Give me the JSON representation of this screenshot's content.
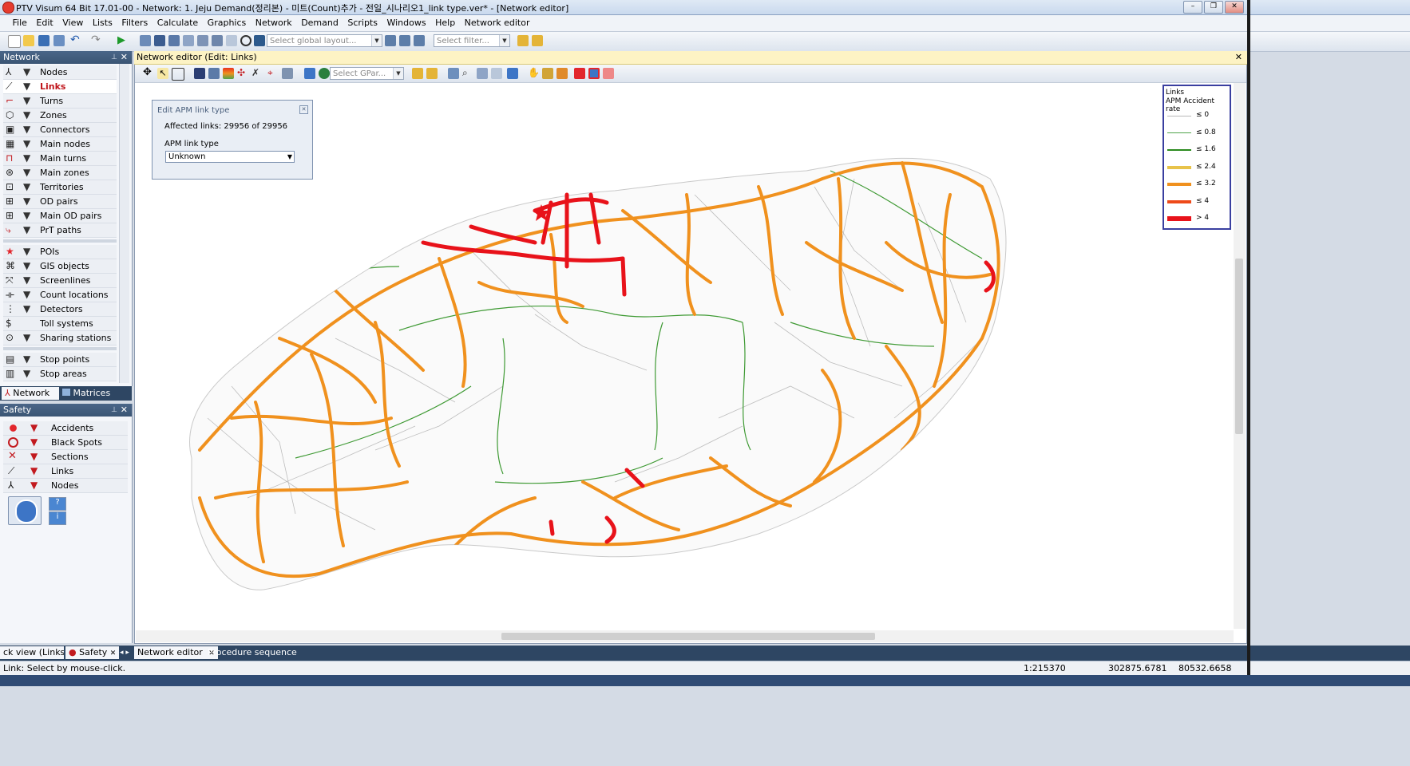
{
  "window": {
    "title": "PTV Visum 64 Bit 17.01-00 - Network: 1. Jeju Demand(정리본) - 미트(Count)추가 - 전일_시나리오1_link type.ver* - [Network editor]",
    "min": "–",
    "max": "❐",
    "close": "✕"
  },
  "menu": [
    "File",
    "Edit",
    "View",
    "Lists",
    "Filters",
    "Calculate",
    "Graphics",
    "Network",
    "Demand",
    "Scripts",
    "Windows",
    "Help",
    "Network editor"
  ],
  "toolbar": {
    "layout_placeholder": "Select global layout...",
    "filter_placeholder": "Select filter..."
  },
  "network_panel": {
    "title": "Network",
    "items": [
      {
        "label": "Nodes",
        "icon": "node-icon"
      },
      {
        "label": "Links",
        "icon": "link-icon",
        "selected": true
      },
      {
        "label": "Turns",
        "icon": "turn-icon"
      },
      {
        "label": "Zones",
        "icon": "zone-icon"
      },
      {
        "label": "Connectors",
        "icon": "connector-icon"
      },
      {
        "label": "Main nodes",
        "icon": "main-node-icon"
      },
      {
        "label": "Main turns",
        "icon": "main-turn-icon"
      },
      {
        "label": "Main zones",
        "icon": "main-zone-icon"
      },
      {
        "label": "Territories",
        "icon": "territory-icon"
      },
      {
        "label": "OD pairs",
        "icon": "od-pair-icon"
      },
      {
        "label": "Main OD pairs",
        "icon": "main-od-pair-icon"
      },
      {
        "label": "PrT paths",
        "icon": "prt-path-icon"
      },
      {
        "label": "POIs",
        "icon": "poi-icon"
      },
      {
        "label": "GIS objects",
        "icon": "gis-icon"
      },
      {
        "label": "Screenlines",
        "icon": "screenline-icon"
      },
      {
        "label": "Count locations",
        "icon": "count-location-icon"
      },
      {
        "label": "Detectors",
        "icon": "detector-icon"
      },
      {
        "label": "Toll systems",
        "icon": "toll-icon"
      },
      {
        "label": "Sharing stations",
        "icon": "sharing-station-icon"
      },
      {
        "label": "Stop points",
        "icon": "stop-point-icon"
      },
      {
        "label": "Stop areas",
        "icon": "stop-area-icon"
      }
    ],
    "tabs": [
      "Network",
      "Matrices"
    ]
  },
  "safety_panel": {
    "title": "Safety",
    "items": [
      "Accidents",
      "Black Spots",
      "Sections",
      "Links",
      "Nodes"
    ]
  },
  "editor": {
    "header": "Network editor (Edit: Links)",
    "gpar_placeholder": "Select GPar..."
  },
  "apm_dialog": {
    "title": "Edit APM link type",
    "affected": "Affected links: 29956 of 29956",
    "field_label": "APM link type",
    "value": "Unknown"
  },
  "legend": {
    "title": "Links",
    "subtitle": "APM Accident rate",
    "entries": [
      {
        "label": "≤ 0",
        "color": "#b8b8b8",
        "width": 1
      },
      {
        "label": "≤ 0.8",
        "color": "#4fa34a",
        "width": 1
      },
      {
        "label": "≤ 1.6",
        "color": "#2a8a1e",
        "width": 2
      },
      {
        "label": "≤ 2.4",
        "color": "#e8c34a",
        "width": 4
      },
      {
        "label": "≤ 3.2",
        "color": "#f0911e",
        "width": 4
      },
      {
        "label": "≤ 4",
        "color": "#ee4a1a",
        "width": 4
      },
      {
        "label": "> 4",
        "color": "#e8121a",
        "width": 6
      }
    ]
  },
  "bottom_tabs": [
    "ck view (Links)",
    "Safety",
    "Network editor",
    "Procedure sequence"
  ],
  "status": {
    "message": "Link: Select by mouse-click.",
    "scale": "1:215370",
    "x": "302875.6781",
    "y": "80532.6658"
  }
}
